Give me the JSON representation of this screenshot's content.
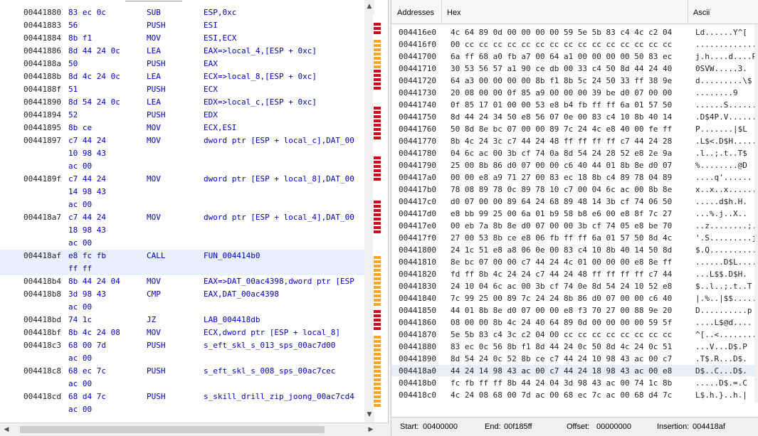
{
  "listing": {
    "rows": [
      {
        "addr": "00441880",
        "bytes": "83 ec 0c",
        "mnemonic": "SUB",
        "operands": "ESP,0xc"
      },
      {
        "addr": "00441883",
        "bytes": "56",
        "mnemonic": "PUSH",
        "operands": "ESI"
      },
      {
        "addr": "00441884",
        "bytes": "8b f1",
        "mnemonic": "MOV",
        "operands": "ESI,ECX"
      },
      {
        "addr": "00441886",
        "bytes": "8d 44 24 0c",
        "mnemonic": "LEA",
        "operands": "EAX=>local_4,[ESP + 0xc]"
      },
      {
        "addr": "0044188a",
        "bytes": "50",
        "mnemonic": "PUSH",
        "operands": "EAX"
      },
      {
        "addr": "0044188b",
        "bytes": "8d 4c 24 0c",
        "mnemonic": "LEA",
        "operands": "ECX=>local_8,[ESP + 0xc]"
      },
      {
        "addr": "0044188f",
        "bytes": "51",
        "mnemonic": "PUSH",
        "operands": "ECX"
      },
      {
        "addr": "00441890",
        "bytes": "8d 54 24 0c",
        "mnemonic": "LEA",
        "operands": "EDX=>local_c,[ESP + 0xc]"
      },
      {
        "addr": "00441894",
        "bytes": "52",
        "mnemonic": "PUSH",
        "operands": "EDX"
      },
      {
        "addr": "00441895",
        "bytes": "8b ce",
        "mnemonic": "MOV",
        "operands": "ECX,ESI"
      },
      {
        "addr": "00441897",
        "bytes": "c7 44 24",
        "mnemonic": "MOV",
        "operands": "dword ptr [ESP + local_c],DAT_00"
      },
      {
        "addr": "",
        "bytes": "10 98 43",
        "mnemonic": "",
        "operands": ""
      },
      {
        "addr": "",
        "bytes": "ac 00",
        "mnemonic": "",
        "operands": ""
      },
      {
        "addr": "0044189f",
        "bytes": "c7 44 24",
        "mnemonic": "MOV",
        "operands": "dword ptr [ESP + local_8],DAT_00"
      },
      {
        "addr": "",
        "bytes": "14 98 43",
        "mnemonic": "",
        "operands": ""
      },
      {
        "addr": "",
        "bytes": "ac 00",
        "mnemonic": "",
        "operands": ""
      },
      {
        "addr": "004418a7",
        "bytes": "c7 44 24",
        "mnemonic": "MOV",
        "operands": "dword ptr [ESP + local_4],DAT_00"
      },
      {
        "addr": "",
        "bytes": "18 98 43",
        "mnemonic": "",
        "operands": ""
      },
      {
        "addr": "",
        "bytes": "ac 00",
        "mnemonic": "",
        "operands": ""
      },
      {
        "addr": "004418af",
        "bytes": "e8 fc fb",
        "mnemonic": "CALL",
        "operands": "FUN_004414b0"
      },
      {
        "addr": "",
        "bytes": "ff ff",
        "mnemonic": "",
        "operands": ""
      },
      {
        "addr": "004418b4",
        "bytes": "8b 44 24 04",
        "mnemonic": "MOV",
        "operands": "EAX=>DAT_00ac4398,dword ptr [ESP"
      },
      {
        "addr": "004418b8",
        "bytes": "3d 98 43",
        "mnemonic": "CMP",
        "operands": "EAX,DAT_00ac4398"
      },
      {
        "addr": "",
        "bytes": "ac 00",
        "mnemonic": "",
        "operands": ""
      },
      {
        "addr": "004418bd",
        "bytes": "74 1c",
        "mnemonic": "JZ",
        "operands": "LAB_004418db"
      },
      {
        "addr": "004418bf",
        "bytes": "8b 4c 24 08",
        "mnemonic": "MOV",
        "operands": "ECX,dword ptr [ESP + local_8]"
      },
      {
        "addr": "004418c3",
        "bytes": "68 00 7d",
        "mnemonic": "PUSH",
        "operands": "s_eft_skl_s_013_sps_00ac7d00"
      },
      {
        "addr": "",
        "bytes": "ac 00",
        "mnemonic": "",
        "operands": ""
      },
      {
        "addr": "004418c8",
        "bytes": "68 ec 7c",
        "mnemonic": "PUSH",
        "operands": "s_eft_skl_s_008_sps_00ac7cec"
      },
      {
        "addr": "",
        "bytes": "ac 00",
        "mnemonic": "",
        "operands": ""
      },
      {
        "addr": "004418cd",
        "bytes": "68 d4 7c",
        "mnemonic": "PUSH",
        "operands": "s_skill_drill_zip_joong_00ac7cd4"
      },
      {
        "addr": "",
        "bytes": "ac 00",
        "mnemonic": "",
        "operands": ""
      }
    ]
  },
  "hex": {
    "headers": {
      "addresses": "Addresses",
      "hex": "Hex",
      "ascii": "Ascii"
    },
    "rows": [
      {
        "addr": "004416e0",
        "hex": "4c 64 89 0d 00 00 00 00 59 5e 5b 83 c4 4c c2 04",
        "ascii": "Ld......Y^["
      },
      {
        "addr": "004416f0",
        "hex": "00 cc cc cc cc cc cc cc cc cc cc cc cc cc cc cc",
        "ascii": "................"
      },
      {
        "addr": "00441700",
        "hex": "6a ff 68 a0 fb a7 00 64 a1 00 00 00 00 50 83 ec",
        "ascii": "j.h....d....P.."
      },
      {
        "addr": "00441710",
        "hex": "30 53 56 57 a1 90 ce db 00 33 c4 50 8d 44 24 40",
        "ascii": "0SVW.....3."
      },
      {
        "addr": "00441720",
        "hex": "64 a3 00 00 00 00 8b f1 8b 5c 24 50 33 ff 38 9e",
        "ascii": "d.........\\$"
      },
      {
        "addr": "00441730",
        "hex": "20 08 00 00 0f 85 a9 00 00 00 39 be d0 07 00 00",
        "ascii": " ........9"
      },
      {
        "addr": "00441740",
        "hex": "0f 85 17 01 00 00 53 e8 b4 fb ff ff 6a 01 57 50",
        "ascii": "......S......."
      },
      {
        "addr": "00441750",
        "hex": "8d 44 24 34 50 e8 56 07 0e 00 83 c4 10 8b 40 14",
        "ascii": ".D$4P.V......"
      },
      {
        "addr": "00441760",
        "hex": "50 8d 8e bc 07 00 00 89 7c 24 4c e8 40 00 fe ff",
        "ascii": "P.......|$L"
      },
      {
        "addr": "00441770",
        "hex": "8b 4c 24 3c c7 44 24 48 ff ff ff ff c7 44 24 28",
        "ascii": ".L$<.D$H....."
      },
      {
        "addr": "00441780",
        "hex": "04 6c ac 00 3b cf 74 0a 8d 54 24 28 52 e8 2e 9a",
        "ascii": ".l..;.t..T$"
      },
      {
        "addr": "00441790",
        "hex": "25 00 8b 86 d0 07 00 00 c6 40 44 01 8b 8e d0 07",
        "ascii": "%........@D"
      },
      {
        "addr": "004417a0",
        "hex": "00 00 e8 a9 71 27 00 83 ec 18 8b c4 89 78 04 89",
        "ascii": "....q'......"
      },
      {
        "addr": "004417b0",
        "hex": "78 08 89 78 0c 89 78 10 c7 00 04 6c ac 00 8b 8e",
        "ascii": "x..x..x......"
      },
      {
        "addr": "004417c0",
        "hex": "d0 07 00 00 89 64 24 68 89 48 14 3b cf 74 06 50",
        "ascii": ".....d$h.H."
      },
      {
        "addr": "004417d0",
        "hex": "e8 bb 99 25 00 6a 01 b9 58 b8 e6 00 e8 8f 7c 27",
        "ascii": "...%.j..X.."
      },
      {
        "addr": "004417e0",
        "hex": "00 eb 7a 8b 8e d0 07 00 00 3b cf 74 05 e8 be 70",
        "ascii": "..z........;."
      },
      {
        "addr": "004417f0",
        "hex": "27 00 53 8b ce e8 06 fb ff ff 6a 01 57 50 8d 4c",
        "ascii": "'.S.........j"
      },
      {
        "addr": "00441800",
        "hex": "24 1c 51 e8 a8 06 0e 00 83 c4 10 8b 40 14 50 8d",
        "ascii": "$.Q.........."
      },
      {
        "addr": "00441810",
        "hex": "8e bc 07 00 00 c7 44 24 4c 01 00 00 00 e8 8e ff",
        "ascii": "......D$L...."
      },
      {
        "addr": "00441820",
        "hex": "fd ff 8b 4c 24 24 c7 44 24 48 ff ff ff ff c7 44",
        "ascii": "...L$$.D$H."
      },
      {
        "addr": "00441830",
        "hex": "24 10 04 6c ac 00 3b cf 74 0e 8d 54 24 10 52 e8",
        "ascii": "$..l..;.t..T"
      },
      {
        "addr": "00441840",
        "hex": "7c 99 25 00 89 7c 24 24 8b 86 d0 07 00 00 c6 40",
        "ascii": "|.%..|$$....."
      },
      {
        "addr": "00441850",
        "hex": "44 01 8b 8e d0 07 00 00 e8 f3 70 27 00 88 9e 20",
        "ascii": "D..........p"
      },
      {
        "addr": "00441860",
        "hex": "08 00 00 8b 4c 24 40 64 89 0d 00 00 00 00 59 5f",
        "ascii": "....L$@d...."
      },
      {
        "addr": "00441870",
        "hex": "5e 5b 83 c4 3c c2 04 00 cc cc cc cc cc cc cc cc",
        "ascii": "^[..<........"
      },
      {
        "addr": "00441880",
        "hex": "83 ec 0c 56 8b f1 8d 44 24 0c 50 8d 4c 24 0c 51",
        "ascii": "...V...D$.P"
      },
      {
        "addr": "00441890",
        "hex": "8d 54 24 0c 52 8b ce c7 44 24 10 98 43 ac 00 c7",
        "ascii": ".T$.R...D$."
      },
      {
        "addr": "004418a0",
        "hex": "44 24 14 98 43 ac 00 c7 44 24 18 98 43 ac 00 e8",
        "ascii": "D$..C...D$."
      },
      {
        "addr": "004418b0",
        "hex": "fc fb ff ff 8b 44 24 04 3d 98 43 ac 00 74 1c 8b",
        "ascii": ".....D$.=.C"
      },
      {
        "addr": "004418c0",
        "hex": "4c 24 08 68 00 7d ac 00 68 ec 7c ac 00 68 d4 7c",
        "ascii": "L$.h.}..h.|"
      }
    ],
    "status": {
      "start_label": "Start:",
      "start_value": "00400000",
      "end_label": "End:",
      "end_value": "00f185ff",
      "offset_label": "Offset:",
      "offset_value": "00000000",
      "insertion_label": "Insertion:",
      "insertion_value": "004418af"
    }
  },
  "colors": {
    "accent_blue": "#0000c8",
    "marker_red": "#d0021b",
    "marker_orange": "#f5a623",
    "selection": "#e6eef8"
  }
}
